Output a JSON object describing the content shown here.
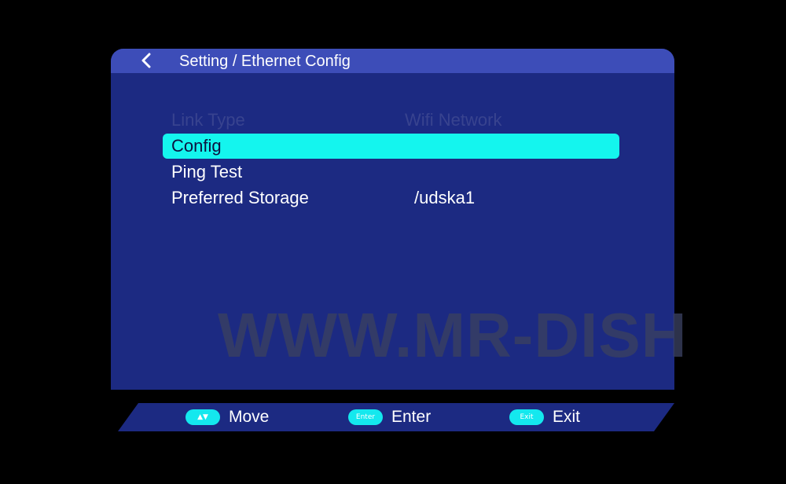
{
  "header": {
    "title": "Setting / Ethernet Config",
    "back_icon": "chevron-left-icon"
  },
  "menu": {
    "items": [
      {
        "label": "Link Type",
        "value": "Wifi Network",
        "state": "disabled"
      },
      {
        "label": "Config",
        "value": "",
        "state": "selected"
      },
      {
        "label": "Ping Test",
        "value": "",
        "state": "normal"
      },
      {
        "label": "Preferred Storage",
        "value": "/udska1",
        "state": "normal"
      }
    ]
  },
  "watermark": "WWW.MR-DISH",
  "footer": {
    "hints": [
      {
        "key": "▲▼",
        "label": "Move"
      },
      {
        "key": "Enter",
        "label": "Enter"
      },
      {
        "key": "Exit",
        "label": "Exit"
      }
    ]
  },
  "colors": {
    "panel": "#1c2a82",
    "header": "#3d4db8",
    "highlight": "#14f5ee",
    "background": "#000000"
  }
}
